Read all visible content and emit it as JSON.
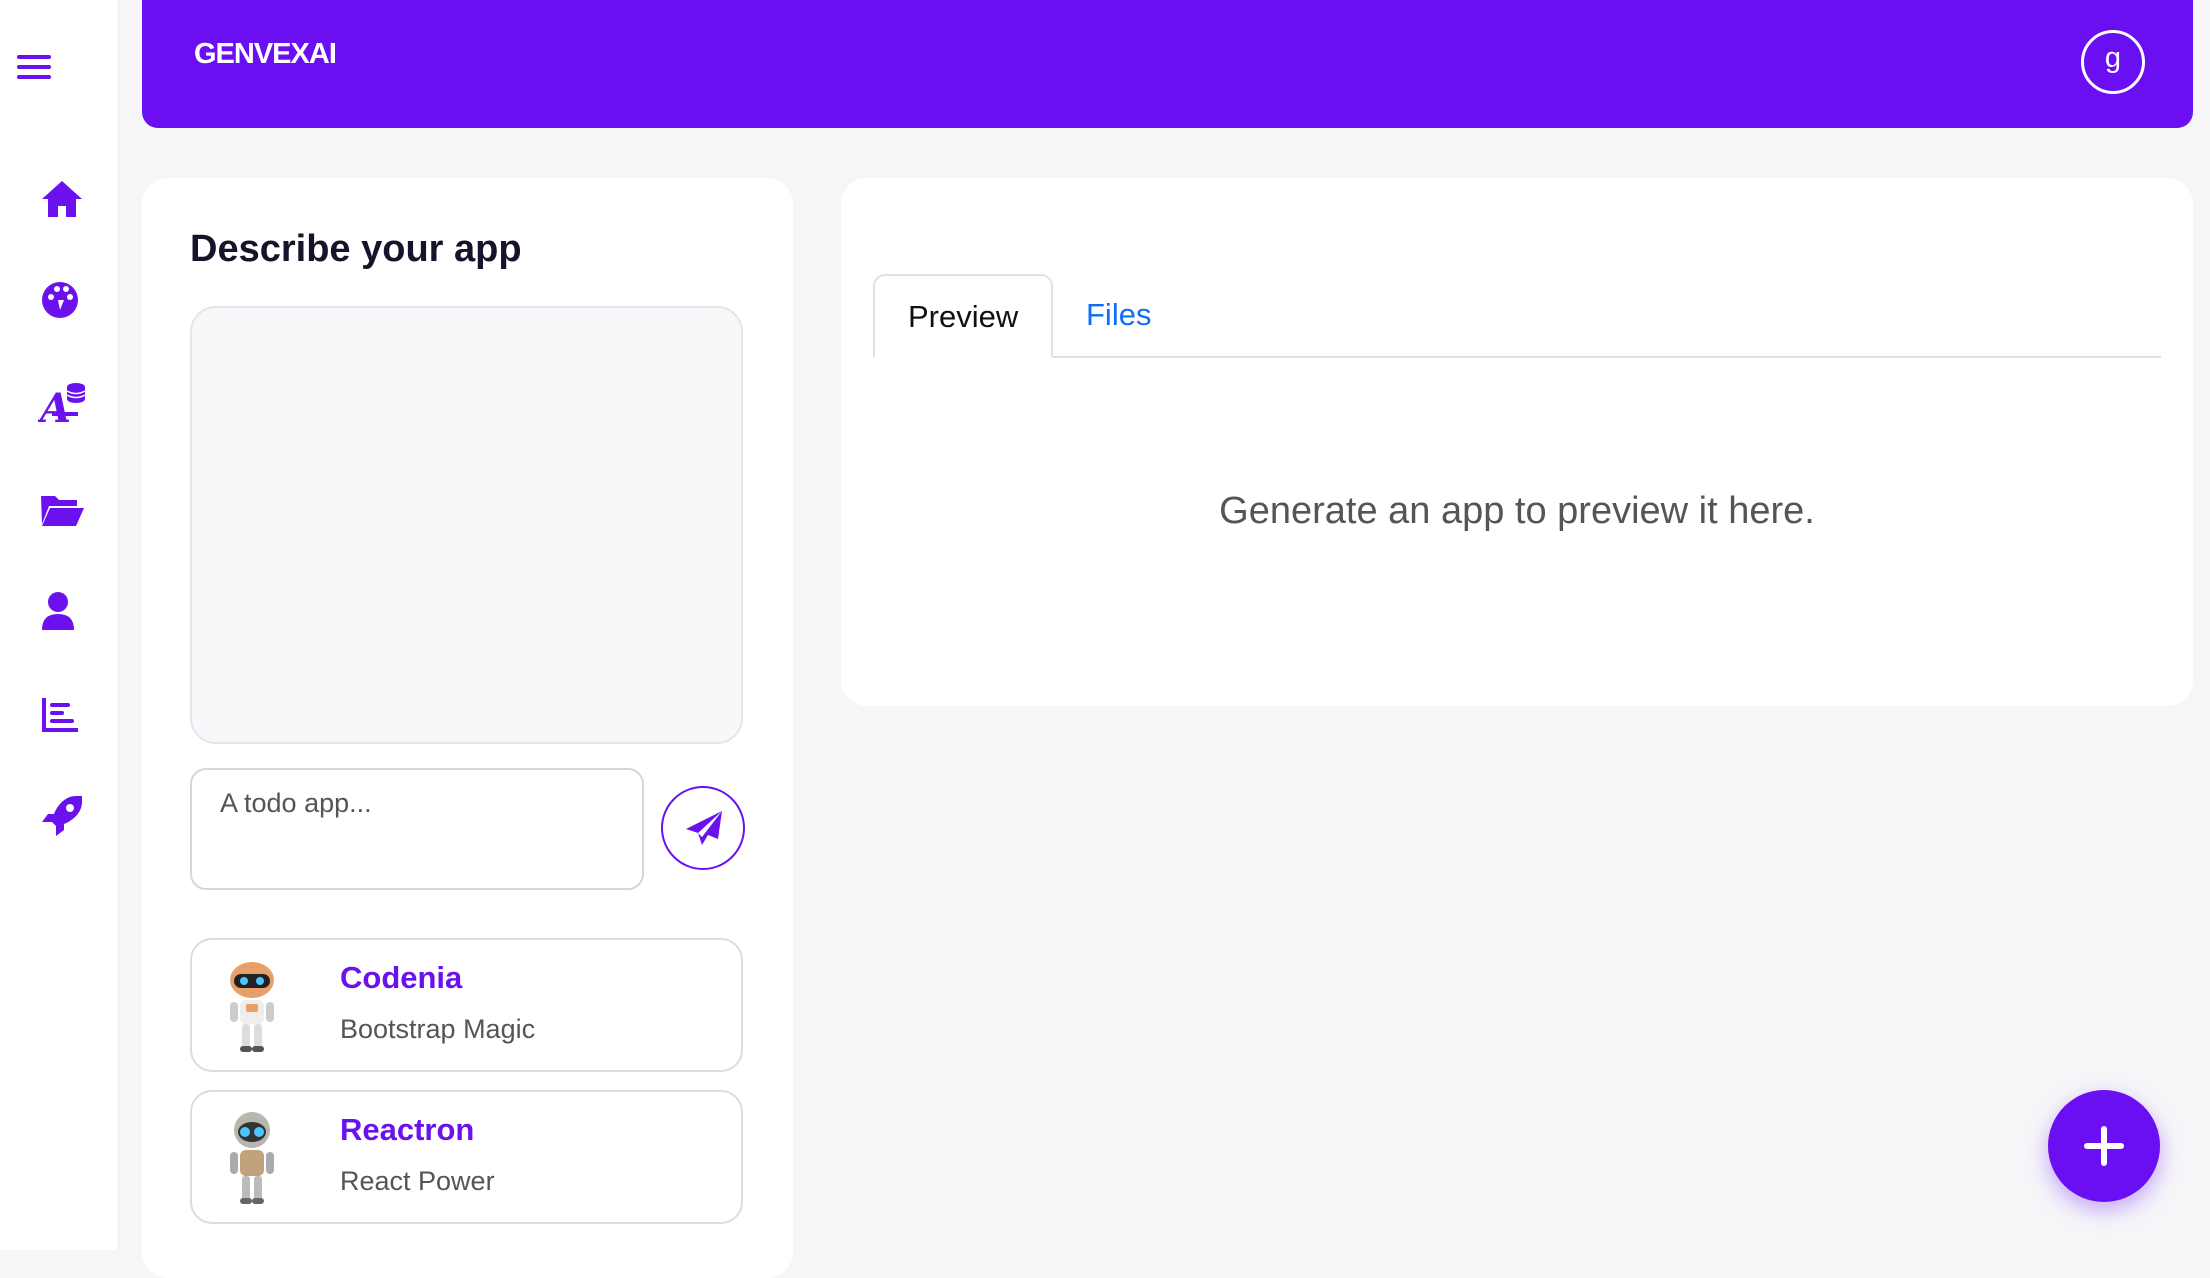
{
  "colors": {
    "brand": "#6a0ff2",
    "accent_text": "#6a11ee",
    "link": "#0d6efd"
  },
  "header": {
    "brand": "GENVEXAI",
    "avatar_initial": "g"
  },
  "sidebar": {
    "items": [
      {
        "icon": "home-icon"
      },
      {
        "icon": "palette-icon"
      },
      {
        "icon": "font-database-icon"
      },
      {
        "icon": "folder-open-icon"
      },
      {
        "icon": "user-icon"
      },
      {
        "icon": "bar-chart-icon"
      },
      {
        "icon": "rocket-icon"
      }
    ]
  },
  "describe": {
    "title": "Describe your app",
    "input_placeholder": "A todo app..."
  },
  "agents": [
    {
      "name": "Codenia",
      "subtitle": "Bootstrap Magic"
    },
    {
      "name": "Reactron",
      "subtitle": "React Power"
    }
  ],
  "preview": {
    "tabs": [
      "Preview",
      "Files"
    ],
    "active_tab": "Preview",
    "empty_message": "Generate an app to preview it here."
  }
}
